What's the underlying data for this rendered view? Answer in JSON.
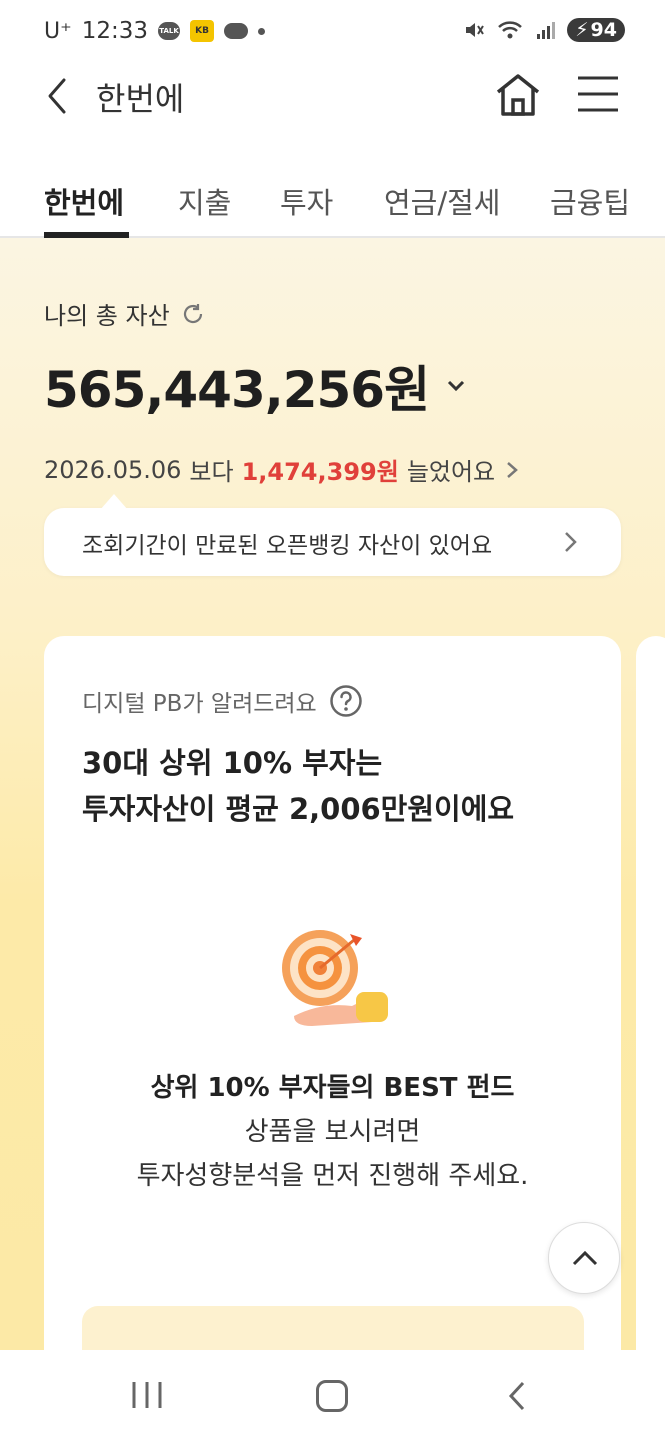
{
  "status_bar": {
    "carrier": "U⁺",
    "time": "12:33",
    "battery": "94",
    "talk_label": "TALK",
    "kb_label": "KB"
  },
  "header": {
    "title": "한번에"
  },
  "tabs": [
    {
      "label": "한번에",
      "active": true
    },
    {
      "label": "지출"
    },
    {
      "label": "투자"
    },
    {
      "label": "연금/절세"
    },
    {
      "label": "금융팁"
    }
  ],
  "assets": {
    "label": "나의 총 자산",
    "total_prefix": "565,443,256",
    "total_unit": "원",
    "compare_date": "2026.05.06",
    "compare_mid": "보다",
    "compare_amount": "1,474,399원",
    "compare_suffix": "늘었어요"
  },
  "notice": {
    "text": "조회기간이 만료된 오픈뱅킹 자산이 있어요"
  },
  "card": {
    "subtitle": "디지털 PB가 알려드려요",
    "title_line1": "30대 상위 10% 부자는",
    "title_line2": "투자자산이 평균 2,006만원이에요",
    "body_line1": "상위 10% 부자들의 BEST 펀드",
    "body_line2": "상품을 보시려면",
    "body_line3": "투자성향분석을 먼저 진행해 주세요."
  },
  "colors": {
    "accent_red": "#e0403a",
    "background_yellow": "#fdeaa8",
    "card_button": "#fdf1cf"
  },
  "icons": [
    "back-icon",
    "home-icon",
    "menu-icon",
    "refresh-icon",
    "chevron-down-icon",
    "chevron-right-icon",
    "help-icon",
    "target-icon",
    "scroll-top-icon"
  ]
}
